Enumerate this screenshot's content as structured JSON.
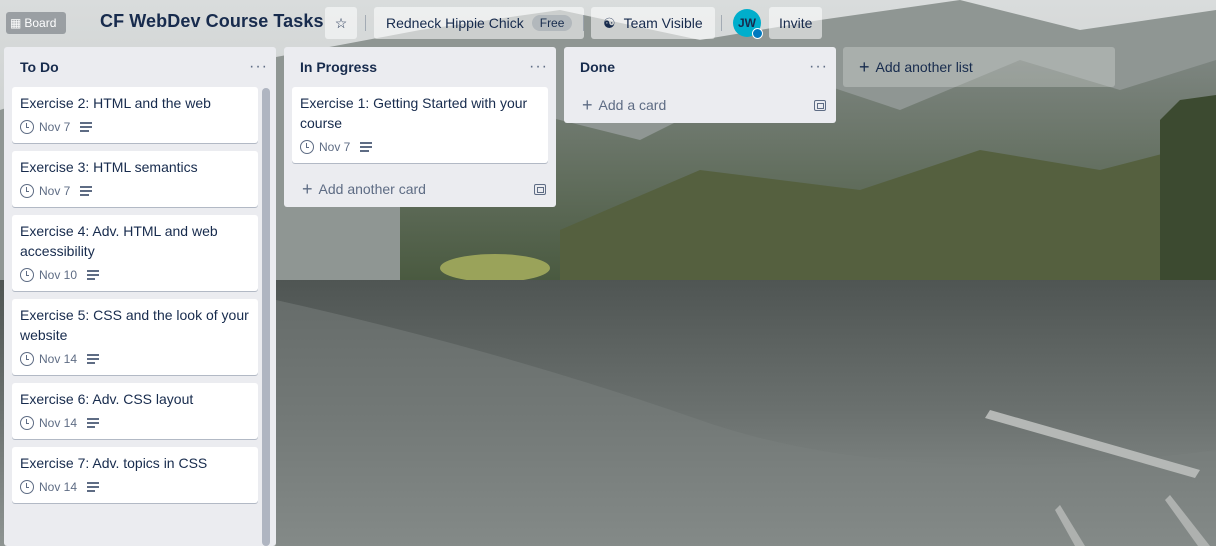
{
  "header": {
    "menu_label": "Board",
    "title": "CF WebDev Course Tasks",
    "team_name": "Redneck Hippie Chick",
    "team_badge": "Free",
    "visibility_label": "Team Visible",
    "avatar_initials": "JW",
    "invite_label": "Invite"
  },
  "lists": [
    {
      "title": "To Do",
      "cards": [
        {
          "title": "Exercise 2: HTML and the web",
          "due": "Nov 7"
        },
        {
          "title": "Exercise 3: HTML semantics",
          "due": "Nov 7"
        },
        {
          "title": "Exercise 4: Adv. HTML and web accessibility",
          "due": "Nov 10"
        },
        {
          "title": "Exercise 5: CSS and the look of your website",
          "due": "Nov 14"
        },
        {
          "title": "Exercise 6: Adv. CSS layout",
          "due": "Nov 14"
        },
        {
          "title": "Exercise 7: Adv. topics in CSS",
          "due": "Nov 14"
        }
      ]
    },
    {
      "title": "In Progress",
      "cards": [
        {
          "title": "Exercise 1: Getting Started with your course",
          "due": "Nov 7"
        }
      ],
      "add_label": "Add another card"
    },
    {
      "title": "Done",
      "cards": [],
      "add_label": "Add a card"
    }
  ],
  "add_list_label": "Add another list",
  "icons": {
    "star": "star-icon",
    "visibility": "team-visibility-icon",
    "due": "clock-icon",
    "description": "description-icon",
    "template": "card-template-icon",
    "menu": "list-menu-icon"
  }
}
